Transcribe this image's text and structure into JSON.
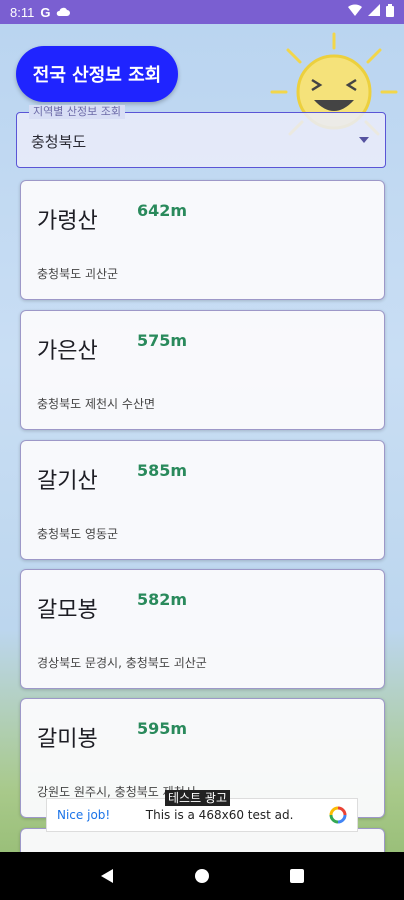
{
  "status_bar": {
    "time": "8:11",
    "left_icons": [
      "g-icon",
      "cloud-icon"
    ],
    "right_icons": [
      "wifi-icon",
      "signal-icon",
      "battery-icon"
    ]
  },
  "header": {
    "title_button": "전국 산정보 조회"
  },
  "region_selector": {
    "label": "지역별 산정보 조회",
    "value": "충청북도"
  },
  "mountains": [
    {
      "name": "가령산",
      "height": "642m",
      "location": "충청북도 괴산군"
    },
    {
      "name": "가은산",
      "height": "575m",
      "location": "충청북도 제천시 수산면"
    },
    {
      "name": "갈기산",
      "height": "585m",
      "location": "충청북도 영동군"
    },
    {
      "name": "갈모봉",
      "height": "582m",
      "location": "경상북도 문경시, 충청북도 괴산군"
    },
    {
      "name": "갈미봉",
      "height": "595m",
      "location": "강원도 원주시, 충청북도 제천시"
    }
  ],
  "ad": {
    "label": "테스트 광고",
    "nice": "Nice job!",
    "text": "This is a 468x60 test ad."
  },
  "colors": {
    "status_bar": "#7a5fd1",
    "title_button": "#1f24ff",
    "height_text": "#2a8a5c"
  }
}
